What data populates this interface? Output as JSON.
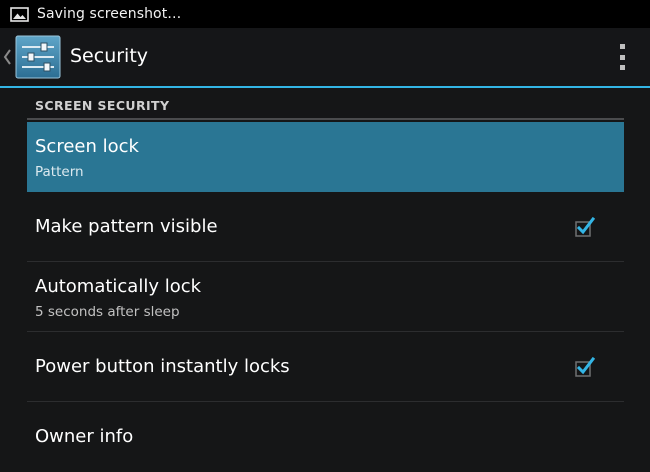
{
  "status_bar": {
    "notification_icon": "image-icon",
    "notification_text": "Saving screenshot…"
  },
  "action_bar": {
    "app_icon": "settings-sliders-icon",
    "title": "Security",
    "overflow_icon": "overflow-menu-icon"
  },
  "accent_color": "#33b5e5",
  "selected_color": "#2a7694",
  "section": {
    "header": "SCREEN SECURITY"
  },
  "items": [
    {
      "title": "Screen lock",
      "summary": "Pattern",
      "selected": true
    },
    {
      "title": "Make pattern visible",
      "checked": true
    },
    {
      "title": "Automatically lock",
      "summary": "5 seconds after sleep"
    },
    {
      "title": "Power button instantly locks",
      "checked": true
    },
    {
      "title": "Owner info"
    }
  ]
}
